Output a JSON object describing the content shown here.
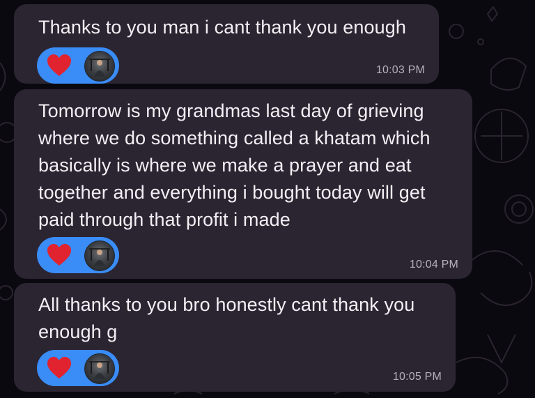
{
  "conversation": {
    "messages": [
      {
        "text": "Thanks to you man i cant thank you enough",
        "time": "10:03 PM",
        "reaction": "heart-icon"
      },
      {
        "text": "Tomorrow is my grandmas last day of grieving\nwhere we do something called a khatam which\nbasically is where we make a prayer and eat\ntogether and everything i bought today will get\npaid through that profit i made",
        "time": "10:04 PM",
        "reaction": "heart-icon"
      },
      {
        "text": "All thanks to you bro honestly cant thank you\nenough g",
        "time": "10:05 PM",
        "reaction": "heart-icon"
      }
    ]
  },
  "colors": {
    "bubble": "#2b2532",
    "reaction_pill": "#3a8cf6",
    "heart": "#e0232e",
    "timestamp": "#b7b0bf",
    "background": "#0b0910"
  }
}
